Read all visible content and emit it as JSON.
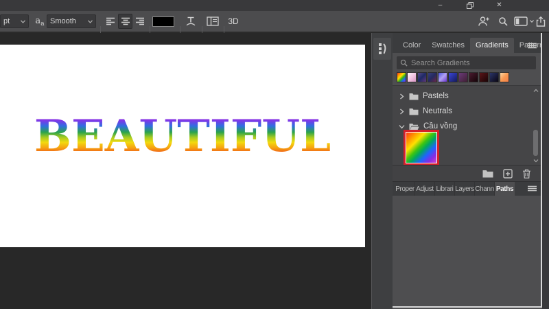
{
  "window": {
    "minimize_glyph": "–",
    "close_glyph": "✕"
  },
  "options_bar": {
    "font_size_value": "pt",
    "anti_alias_label_big": "a",
    "anti_alias_label_small": "a",
    "smoothing_value": "Smooth",
    "threed_label": "3D",
    "text_color": "#000000"
  },
  "canvas": {
    "text": "BEAUTIFUL",
    "text_gradient": "linear-gradient(180deg,#c32bd5 0%,#7a3ae8 14%,#2f6fe0 26%,#2ba34c 40%,#a9cc1f 52%,#f2d90f 63%,#f6a011 76%,#ee4e1b 89%,#e42a16 100%)",
    "background": "#ffffff"
  },
  "gradients_panel": {
    "tabs": [
      {
        "label": "Color",
        "active": false
      },
      {
        "label": "Swatches",
        "active": false
      },
      {
        "label": "Gradients",
        "active": true
      },
      {
        "label": "Patterns",
        "active": false
      }
    ],
    "search_placeholder": "Search Gradients",
    "recent_swatches": [
      "linear-gradient(135deg,#ff2a1e,#ff9000,#ffe000,#2fb31a,#1f63ff,#8a2be2)",
      "linear-gradient(135deg,#fdf7fb,#f3c6e2,#d795c5)",
      "linear-gradient(135deg,#584a88,#1e2a66,#643a7c)",
      "linear-gradient(135deg,#3a3f7e,#242a60,#6a2748)",
      "linear-gradient(135deg,#4a52e0,#b2a2f2,#6a35d0)",
      "linear-gradient(135deg,#3a46d8,#141a5a)",
      "linear-gradient(135deg,#6a3a78,#401f34)",
      "linear-gradient(135deg,#4a1a2e,#140408)",
      "linear-gradient(135deg,#5a1518,#1a0406)",
      "linear-gradient(135deg,#2a3468,#0a0612)",
      "linear-gradient(135deg,#ffd9a6,#fa9a52,#f47e48)"
    ],
    "groups": [
      {
        "name": "Pastels",
        "expanded": false
      },
      {
        "name": "Neutrals",
        "expanded": false
      },
      {
        "name": "Cầu vồng",
        "expanded": true
      }
    ],
    "selected_swatch": {
      "gradient": "linear-gradient(135deg,#ff2a1e 0%,#ff8a00 16%,#ffe000 32%,#3fc510 46%,#00a85e 56%,#1f63ff 70%,#8a2be2 84%,#e049c8 100%)",
      "selection_color": "#d5202a"
    }
  },
  "bottom_panel": {
    "tabs": [
      {
        "label": "Proper",
        "active": false
      },
      {
        "label": "Adjust",
        "active": false
      },
      {
        "label": "Librari",
        "active": false
      },
      {
        "label": "Layers",
        "active": false
      },
      {
        "label": "Chann",
        "active": false
      },
      {
        "label": "Paths",
        "active": true
      }
    ]
  }
}
